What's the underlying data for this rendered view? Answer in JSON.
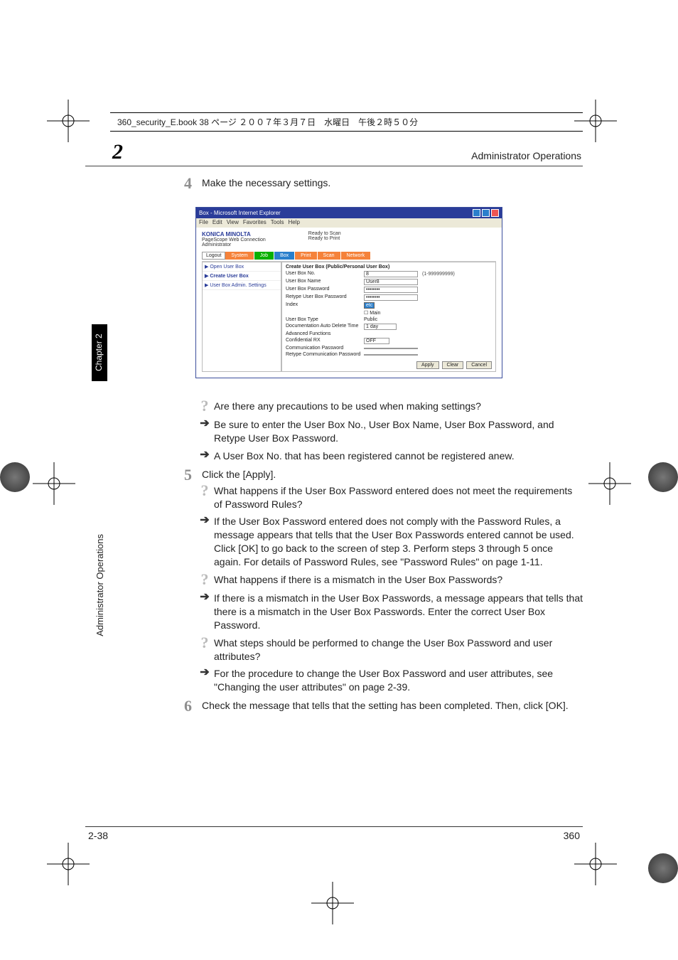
{
  "meta": {
    "book_header": "360_security_E.book  38 ページ  ２００７年３月７日　水曜日　午後２時５０分"
  },
  "header": {
    "chapter_big": "2",
    "title_right": "Administrator Operations"
  },
  "sidebar": {
    "chapter_label": "Chapter 2",
    "section_label": "Administrator Operations"
  },
  "steps": {
    "s4": {
      "num": "4",
      "text": "Make the necessary settings."
    },
    "s5": {
      "num": "5",
      "text": "Click the [Apply]."
    },
    "s6": {
      "num": "6",
      "text": "Check the message that tells that the setting has been completed. Then, click [OK]."
    }
  },
  "qa4": {
    "q1": "Are there any precautions to be used when making settings?",
    "a1": "Be sure to enter the User Box No., User Box Name, User Box Password, and Retype User Box Password.",
    "a2": "A User Box No. that has been registered cannot be registered anew."
  },
  "qa5": {
    "q1": "What happens if the User Box Password entered does not meet the requirements of Password Rules?",
    "a1": "If the User Box Password entered does not comply with the Password Rules, a message appears that tells that the User Box Passwords entered cannot be used. Click [OK] to go back to the screen of step 3. Perform steps 3 through 5 once again. For details of Password Rules, see \"Password Rules\" on page 1-11.",
    "q2": "What happens if there is a mismatch in the User Box Passwords?",
    "a2": "If there is a mismatch in the User Box Passwords, a message appears that tells that there is a mismatch in the User Box Passwords. Enter the correct User Box Password.",
    "q3": "What steps should be performed to change the User Box Password and user attributes?",
    "a3": "For the procedure to change the User Box Password and user attributes, see \"Changing the user attributes\" on page 2-39."
  },
  "footer": {
    "left": "2-38",
    "right": "360"
  },
  "screenshot": {
    "title": "Box - Microsoft Internet Explorer",
    "menu": [
      "File",
      "Edit",
      "View",
      "Favorites",
      "Tools",
      "Help"
    ],
    "brand1": "KONICA MINOLTA",
    "brand2": "PageScope Web Connection",
    "status1": "Ready to Scan",
    "status2": "Ready to Print",
    "role": "Administrator",
    "nav": {
      "logout": "Logout",
      "tabs": [
        "System",
        "Job",
        "Box",
        "Print",
        "Scan",
        "Network"
      ]
    },
    "side": {
      "open": "▶ Open User Box",
      "create": "▶ Create User Box",
      "admin": "▶ User Box Admin. Settings"
    },
    "form": {
      "title": "Create User Box (Public/Personal User Box)",
      "fields": {
        "no_label": "User Box No.",
        "no_val": "8",
        "no_hint": "(1-999999999)",
        "name_label": "User Box Name",
        "name_val": "User8",
        "pw_label": "User Box Password",
        "pw_val": "••••••••",
        "rpw_label": "Retype User Box Password",
        "rpw_val": "••••••••",
        "index_label": "Index",
        "index_val": "etc",
        "main_label": "Main",
        "type_label": "User Box Type",
        "type_val": "Public",
        "auto_label": "Documentation Auto Delete Time",
        "auto_val": "1 day",
        "adv_label": "Advanced Functions",
        "conf_label": "Confidential RX",
        "conf_val": "OFF",
        "comm_label": "Communication Password",
        "rcomm_label": "Retype Communication Password"
      },
      "buttons": [
        "Apply",
        "Clear",
        "Cancel"
      ]
    }
  }
}
